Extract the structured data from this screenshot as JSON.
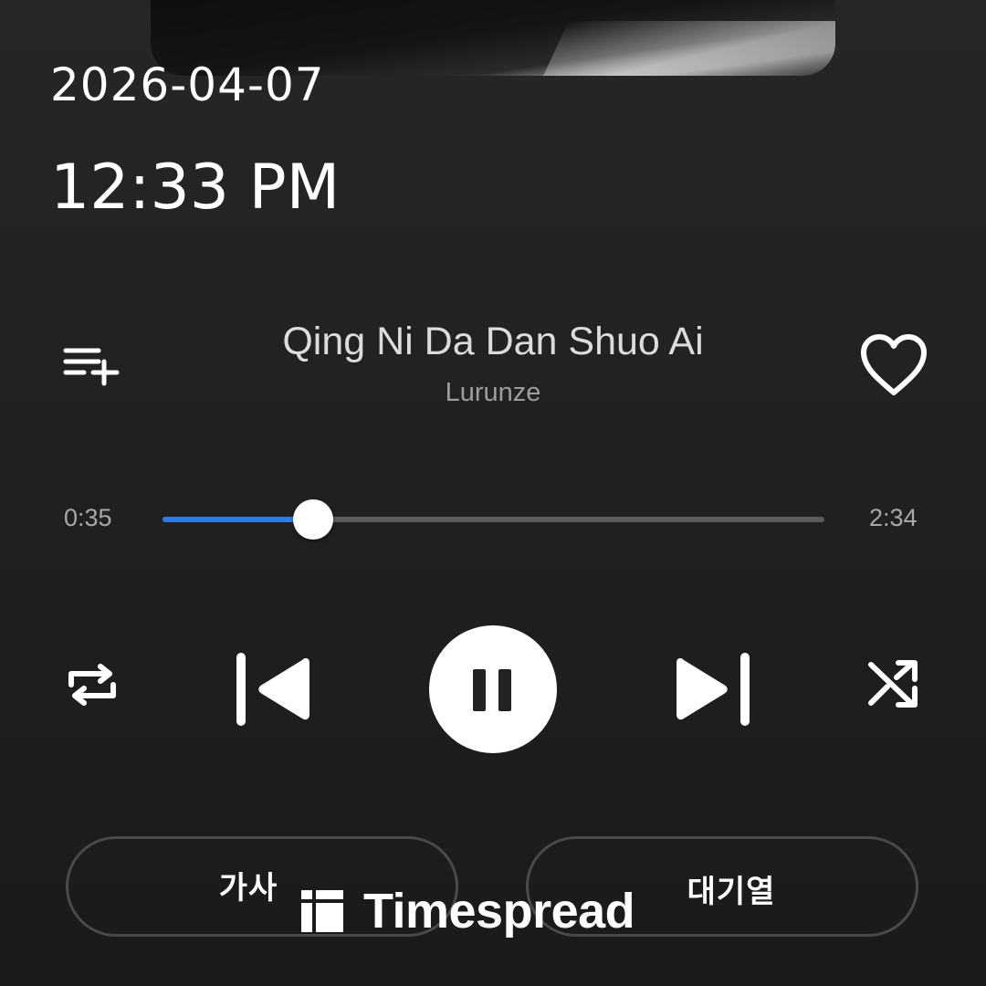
{
  "status": {
    "date": "2026-04-07",
    "time": "12:33 PM"
  },
  "track": {
    "title": "Qing Ni Da Dan Shuo Ai",
    "artist": "Lurunze",
    "elapsed": "0:35",
    "duration": "2:34",
    "progress_fraction": 0.227,
    "liked": false
  },
  "controls": {
    "queue_add_icon": "playlist-add-icon",
    "favorite_icon": "heart-outline-icon",
    "repeat_icon": "repeat-icon",
    "previous_icon": "skip-previous-icon",
    "play_state_icon": "pause-icon",
    "next_icon": "skip-next-icon",
    "shuffle_icon": "shuffle-icon"
  },
  "buttons": {
    "lyrics_label": "가사",
    "queue_label": "대기열"
  },
  "watermark": {
    "text": "Timespread"
  },
  "colors": {
    "accent": "#2f7de1",
    "background": "#1f1f1f",
    "track_bg": "#5c5c5c"
  }
}
